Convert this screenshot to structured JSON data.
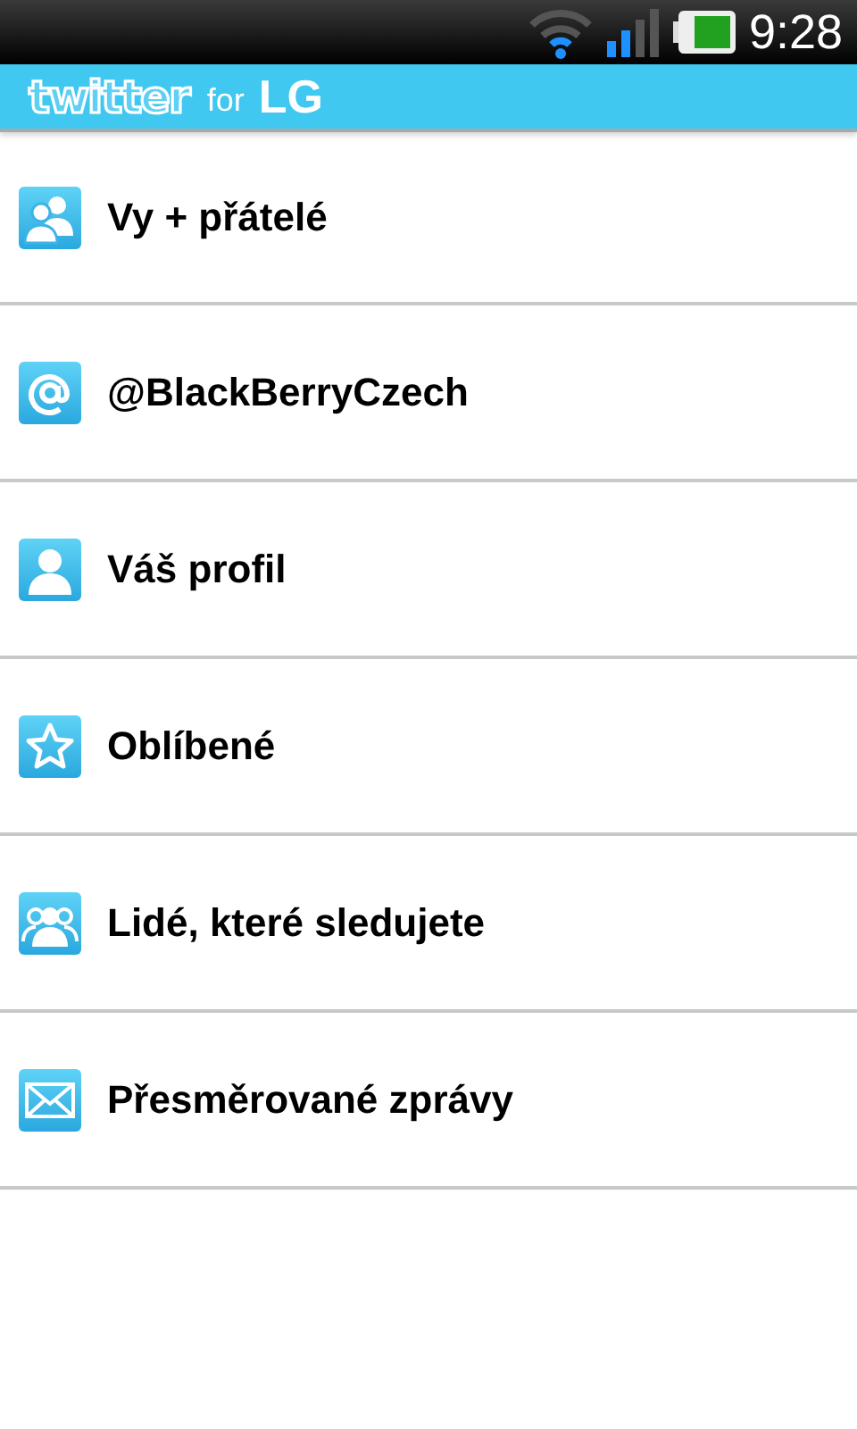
{
  "status_bar": {
    "time": "9:28"
  },
  "header": {
    "logo": "twitter",
    "for": "for",
    "brand": "LG"
  },
  "menu": [
    {
      "kind": "friends",
      "label": "Vy + přátelé"
    },
    {
      "kind": "mention",
      "label": "@BlackBerryCzech"
    },
    {
      "kind": "profile",
      "label": "Váš profil"
    },
    {
      "kind": "favorites",
      "label": "Oblíbené"
    },
    {
      "kind": "following",
      "label": "Lidé, které sledujete"
    },
    {
      "kind": "messages",
      "label": "Přesměrované zprávy"
    }
  ]
}
